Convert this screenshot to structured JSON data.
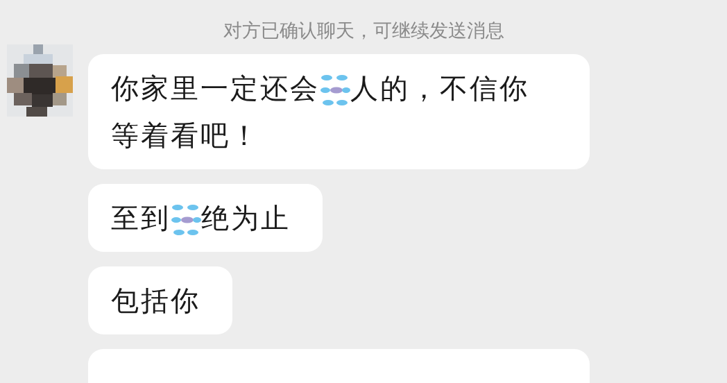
{
  "system_note": "对方已确认聊天，可继续发送消息",
  "messages": [
    {
      "kind": "bubble",
      "parts": [
        {
          "kind": "text",
          "text": "你家里一定还会"
        },
        {
          "kind": "sticker"
        },
        {
          "kind": "text",
          "text": "人的，不信你等着看吧！"
        }
      ]
    },
    {
      "kind": "bubble",
      "parts": [
        {
          "kind": "text",
          "text": "至到"
        },
        {
          "kind": "sticker"
        },
        {
          "kind": "text",
          "text": "绝为止"
        }
      ]
    },
    {
      "kind": "bubble",
      "parts": [
        {
          "kind": "text",
          "text": "包括你"
        }
      ]
    },
    {
      "kind": "cut"
    }
  ]
}
